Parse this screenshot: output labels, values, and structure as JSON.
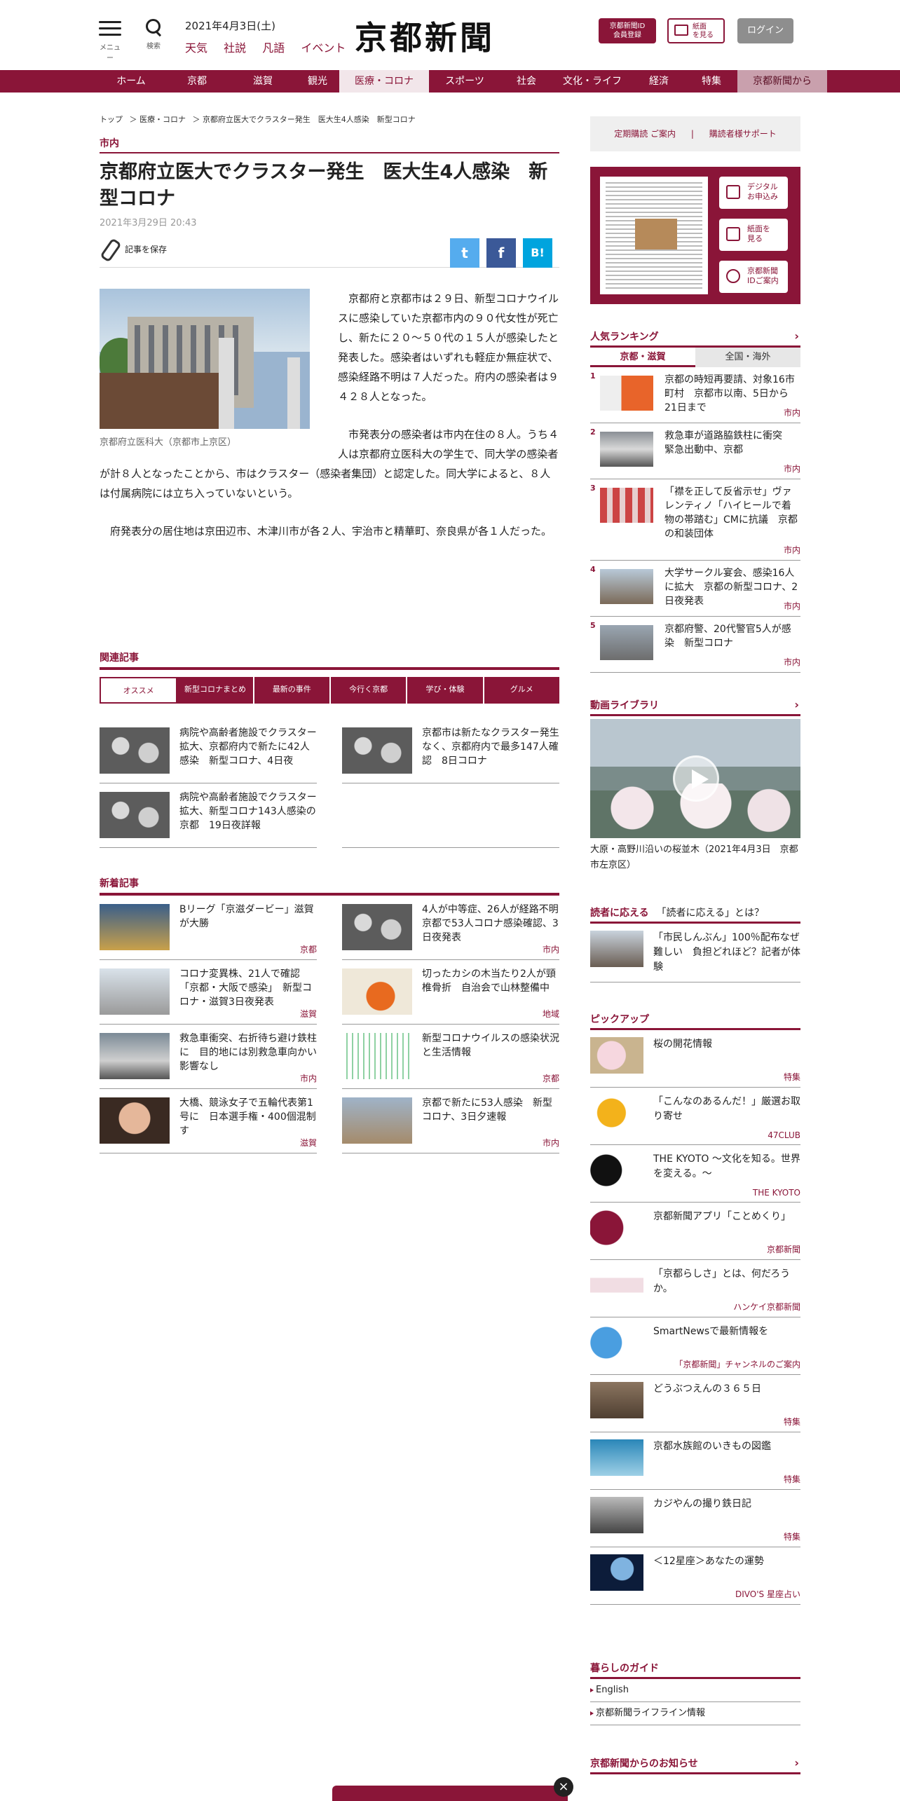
{
  "header": {
    "menu_caption": "メニュー",
    "search_caption": "検索",
    "date": "2021年4月3日(土)",
    "quick_links": [
      "天気",
      "社説",
      "凡語",
      "イベント"
    ],
    "logo": "京都新聞",
    "member_button": "京都新聞ID\n会員登録",
    "paper_button": "紙面\nを見る",
    "login_button": "ログイン"
  },
  "nav": {
    "items": [
      "ホーム",
      "京都",
      "滋賀",
      "観光",
      "医療・コロナ",
      "スポーツ",
      "社会",
      "文化・ライフ",
      "経済",
      "特集",
      "京都新聞から"
    ],
    "active_index": 4
  },
  "breadcrumb": [
    "トップ",
    "＞ 医療・コロナ",
    "＞ 京都府立医大でクラスター発生　医大生4人感染　新型コロナ"
  ],
  "article": {
    "section": "市内",
    "headline": "京都府立医大でクラスター発生　医大生4人感染　新型コロナ",
    "date": "2021年3月29日 20:43",
    "save_label": "記事を保存",
    "share_labels": [
      "t",
      "f",
      "B!"
    ],
    "caption": "京都府立医科大（京都市上京区）",
    "paragraphs": [
      "京都府と京都市は２９日、新型コロナウイルスに感染していた京都市内の９０代女性が死亡し、新たに２０～５０代の１５人が感染したと発表した。感染者はいずれも軽症か無症状で、感染経路不明は７人だった。府内の感染者は９４２８人となった。",
      "市発表分の感染者は市内在住の８人。うち４人は京都府立医科大の学生で、同大学の感染者が計８人となったことから、市はクラスター（感染者集団）と認定した。同大学によると、８人は付属病院には立ち入っていないという。",
      "府発表分の居住地は京田辺市、木津川市が各２人、宇治市と精華町、奈良県が各１人だった。"
    ]
  },
  "related": {
    "title": "関連記事",
    "tabs": [
      "オススメ",
      "新型コロナまとめ",
      "最新の事件",
      "今行く京都",
      "学び・体験",
      "グルメ"
    ],
    "items": [
      {
        "title": "病院や高齢者施設でクラスター拡大、京都府内で新たに42人感染　新型コロナ、4日夜"
      },
      {
        "title": "京都市は新たなクラスター発生なく、京都府内で最多147人確認　8日コロナ"
      },
      {
        "title": "病院や高齢者施設でクラスター拡大、新型コロナ143人感染の京都　19日夜詳報"
      }
    ]
  },
  "new_articles": {
    "title": "新着記事",
    "items": [
      {
        "title": "Bリーグ「京滋ダービー」滋賀が大勝",
        "tag": "京都"
      },
      {
        "title": "4人が中等症、26人が経路不明　京都で53人コロナ感染確認、3日夜発表",
        "tag": "市内"
      },
      {
        "title": "コロナ変異株、21人で確認　「京都・大阪で感染」　新型コロナ・滋賀3日夜発表",
        "tag": "滋賀"
      },
      {
        "title": "切ったカシの木当たり2人が頸椎骨折　自治会で山林整備中",
        "tag": "地域"
      },
      {
        "title": "救急車衝突、右折待ち避け鉄柱に　目的地には別救急車向かい影響なし",
        "tag": "市内"
      },
      {
        "title": "新型コロナウイルスの感染状況と生活情報",
        "tag": "京都"
      },
      {
        "title": "大橋、競泳女子で五輪代表第1号に　日本選手権・400個混制す",
        "tag": "滋賀"
      },
      {
        "title": "京都で新たに53人感染　新型コロナ、3日夕速報",
        "tag": "市内"
      }
    ]
  },
  "sidebar": {
    "support": {
      "subscribe": "定期購読 ご案内",
      "separator": "|",
      "support": "購読者様サポート"
    },
    "promo_buttons": [
      "デジタル\nお申込み",
      "紙面を\n見る",
      "京都新聞\nIDご案内"
    ],
    "ranking": {
      "title": "人気ランキング",
      "chevron": "›",
      "tabs": [
        "京都・滋賀",
        "全国・海外"
      ],
      "items": [
        {
          "no": "1",
          "title": "京都の時短再要請、対象16市町村　京都市以南、5日から21日まで",
          "tag": "市内"
        },
        {
          "no": "2",
          "title": "救急車が道路脇鉄柱に衝突　緊急出動中、京都",
          "tag": "市内"
        },
        {
          "no": "3",
          "title": "「襟を正して反省示せ」ヴァレンティノ「ハイヒールで着物の帯踏む」CMに抗議　京都の和装団体",
          "tag": "市内"
        },
        {
          "no": "4",
          "title": "大学サークル宴会、感染16人に拡大　京都の新型コロナ、2日夜発表",
          "tag": "市内"
        },
        {
          "no": "5",
          "title": "京都府警、20代警官5人が感染　新型コロナ",
          "tag": "市内"
        }
      ]
    },
    "video": {
      "title": "動画ライブラリ",
      "chevron": "›",
      "caption": "大原・高野川沿いの桜並木（2021年4月3日　京都市左京区）"
    },
    "answer": {
      "title": "読者に応える",
      "link": "「読者に応える」とは？",
      "item": "「市民しんぶん」100％配布なぜ難しい　負担どれほど？記者が体験"
    },
    "pickup": {
      "title": "ピックアップ",
      "items": [
        {
          "title": "桜の開花情報",
          "tag": "特集"
        },
        {
          "title": "「こんなのあるんだ！」厳選お取り寄せ",
          "tag": "47CLUB"
        },
        {
          "title": "THE KYOTO ～文化を知る。世界を変える。～",
          "tag": "THE KYOTO"
        },
        {
          "title": "京都新聞アプリ「ことめくり」",
          "tag": "京都新聞"
        },
        {
          "title": "「京都らしさ」とは、何だろうか。",
          "tag": "ハンケイ京都新聞"
        },
        {
          "title": "SmartNewsで最新情報を",
          "tag": "「京都新聞」チャンネルのご案内"
        },
        {
          "title": "どうぶつえんの３６５日",
          "tag": "特集"
        },
        {
          "title": "京都水族館のいきもの図鑑",
          "tag": "特集"
        },
        {
          "title": "カジやんの撮り鉄日記",
          "tag": "特集"
        },
        {
          "title": "＜12星座＞あなたの運勢",
          "tag": "DIVO'S 星座占い"
        }
      ]
    },
    "guide": {
      "title": "暮らしのガイド",
      "items": [
        "English",
        "京都新聞ライフライン情報"
      ]
    },
    "notice": {
      "title": "京都新聞からのお知らせ",
      "chevron": "›"
    }
  },
  "overlay": {
    "close": "×"
  },
  "colors": {
    "accent": "#8a1538",
    "twitter": "#55acee",
    "facebook": "#3b5998",
    "hatena": "#00a4de"
  }
}
